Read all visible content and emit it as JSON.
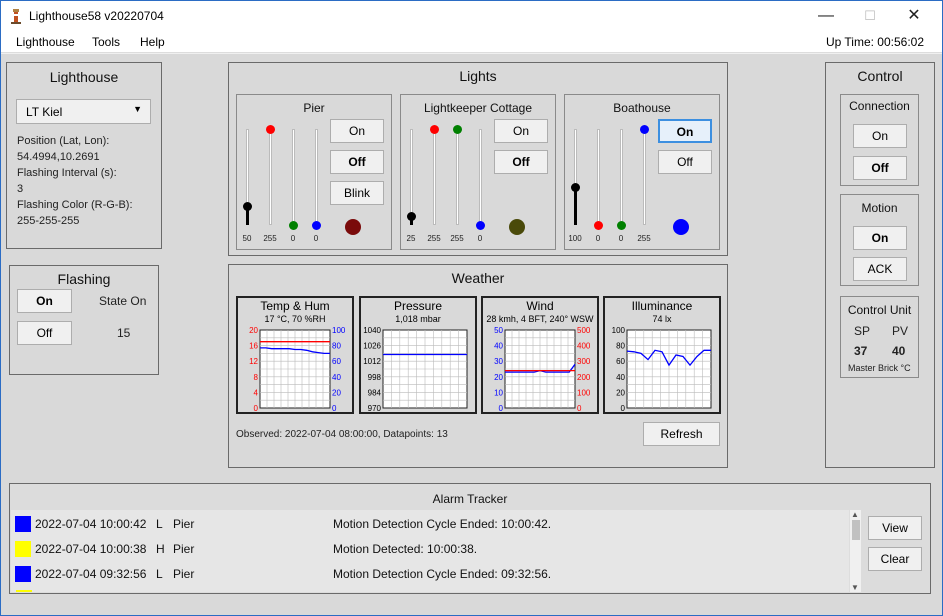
{
  "window": {
    "title": "Lighthouse58 v20220704",
    "uptime": "Up Time: 00:56:02"
  },
  "menu": [
    "Lighthouse",
    "Tools",
    "Help"
  ],
  "lighthouse": {
    "title": "Lighthouse",
    "selected": "LT Kiel",
    "position_label": "Position (Lat, Lon):",
    "position_value": "54.4994,10.2691",
    "interval_label": "Flashing Interval (s):",
    "interval_value": "3",
    "color_label": "Flashing Color (R-G-B):",
    "color_value": "255-255-255"
  },
  "flashing": {
    "title": "Flashing",
    "on_label": "On",
    "off_label": "Off",
    "state_label": "State On",
    "count": "15"
  },
  "lights": {
    "title": "Lights",
    "groups": [
      {
        "name": "Pier",
        "sliders": [
          {
            "value": "50",
            "level": 50,
            "color": "#000000"
          },
          {
            "value": "255",
            "level": 255,
            "color": "#ff0000"
          },
          {
            "value": "0",
            "level": 0,
            "color": "#008000"
          },
          {
            "value": "0",
            "level": 0,
            "color": "#0000ff"
          }
        ],
        "buttons": [
          "On",
          "Off",
          "Blink"
        ],
        "lamp_color": "#7a0b0b"
      },
      {
        "name": "Lightkeeper Cottage",
        "sliders": [
          {
            "value": "25",
            "level": 25,
            "color": "#000000"
          },
          {
            "value": "255",
            "level": 255,
            "color": "#ff0000"
          },
          {
            "value": "255",
            "level": 255,
            "color": "#008000"
          },
          {
            "value": "0",
            "level": 0,
            "color": "#0000ff"
          }
        ],
        "buttons": [
          "On",
          "Off"
        ],
        "lamp_color": "#4a4a0a"
      },
      {
        "name": "Boathouse",
        "sliders": [
          {
            "value": "100",
            "level": 100,
            "color": "#000000"
          },
          {
            "value": "0",
            "level": 0,
            "color": "#ff0000"
          },
          {
            "value": "0",
            "level": 0,
            "color": "#008000"
          },
          {
            "value": "255",
            "level": 255,
            "color": "#0000ff"
          }
        ],
        "buttons": [
          "On",
          "Off"
        ],
        "lamp_color": "#0000ff"
      }
    ]
  },
  "weather": {
    "title": "Weather",
    "observed": "Observed: 2022-07-04 08:00:00, Datapoints: 13",
    "refresh_label": "Refresh"
  },
  "chart_data": [
    {
      "type": "line",
      "title": "Temp & Hum",
      "subtitle": "17 °C, 70 %RH",
      "left_ticks": [
        "20",
        "16",
        "12",
        "8",
        "4",
        "0"
      ],
      "right_ticks": [
        "100",
        "80",
        "60",
        "40",
        "20",
        "0"
      ],
      "left_color": "#ff0000",
      "right_color": "#0000ff",
      "series": [
        {
          "axis": "left",
          "ylim": [
            0,
            20
          ],
          "color": "#ff0000",
          "values": [
            17,
            17,
            17,
            17,
            17,
            17,
            17,
            17,
            17,
            17,
            17,
            17,
            17
          ]
        },
        {
          "axis": "right",
          "ylim": [
            0,
            100
          ],
          "color": "#0000ff",
          "values": [
            77,
            77,
            76,
            76,
            76,
            76,
            75,
            75,
            74,
            72,
            71,
            70,
            70
          ]
        }
      ]
    },
    {
      "type": "line",
      "title": "Pressure",
      "subtitle": "1,018 mbar",
      "left_ticks": [
        "1040",
        "1026",
        "1012",
        "998",
        "984",
        "970"
      ],
      "left_color": "#000000",
      "series": [
        {
          "axis": "left",
          "ylim": [
            970,
            1040
          ],
          "color": "#0000ff",
          "values": [
            1018,
            1018,
            1018,
            1018,
            1018,
            1018,
            1018,
            1018,
            1018,
            1018,
            1018,
            1018,
            1018
          ]
        }
      ]
    },
    {
      "type": "line",
      "title": "Wind",
      "subtitle": "28 kmh, 4 BFT, 240° WSW",
      "left_ticks": [
        "50",
        "40",
        "30",
        "20",
        "10",
        "0"
      ],
      "right_ticks": [
        "500",
        "400",
        "300",
        "200",
        "100",
        "0"
      ],
      "left_color": "#0000ff",
      "right_color": "#ff0000",
      "series": [
        {
          "axis": "left",
          "ylim": [
            0,
            50
          ],
          "color": "#0000ff",
          "values": [
            23,
            23,
            23,
            23,
            23,
            23,
            24,
            23,
            23,
            23,
            23,
            23,
            28
          ]
        },
        {
          "axis": "right",
          "ylim": [
            0,
            500
          ],
          "color": "#ff0000",
          "values": [
            240,
            240,
            240,
            240,
            240,
            240,
            240,
            240,
            240,
            240,
            240,
            240,
            240
          ]
        }
      ]
    },
    {
      "type": "line",
      "title": "Illuminance",
      "subtitle": "74 lx",
      "left_ticks": [
        "100",
        "80",
        "60",
        "40",
        "20",
        "0"
      ],
      "left_color": "#000000",
      "series": [
        {
          "axis": "left",
          "ylim": [
            0,
            100
          ],
          "color": "#0000ff",
          "values": [
            73,
            72,
            70,
            62,
            74,
            72,
            55,
            68,
            66,
            55,
            66,
            74,
            74
          ]
        }
      ]
    }
  ],
  "control": {
    "title": "Control",
    "connection_title": "Connection",
    "connection_on": "On",
    "connection_off": "Off",
    "motion_title": "Motion",
    "motion_on": "On",
    "motion_ack": "ACK",
    "unit_title": "Control Unit",
    "sp_label": "SP",
    "pv_label": "PV",
    "sp_value": "37",
    "pv_value": "40",
    "unit_footer": "Master Brick °C"
  },
  "alarms": {
    "title": "Alarm Tracker",
    "view_label": "View",
    "clear_label": "Clear",
    "rows": [
      {
        "color": "#0000ff",
        "time": "2022-07-04 10:00:42",
        "level": "L",
        "source": "Pier",
        "message": "Motion Detection Cycle Ended: 10:00:42."
      },
      {
        "color": "#ffff00",
        "time": "2022-07-04 10:00:38",
        "level": "H",
        "source": "Pier",
        "message": "Motion Detected: 10:00:38."
      },
      {
        "color": "#0000ff",
        "time": "2022-07-04 09:32:56",
        "level": "L",
        "source": "Pier",
        "message": "Motion Detection Cycle Ended: 09:32:56."
      }
    ]
  }
}
